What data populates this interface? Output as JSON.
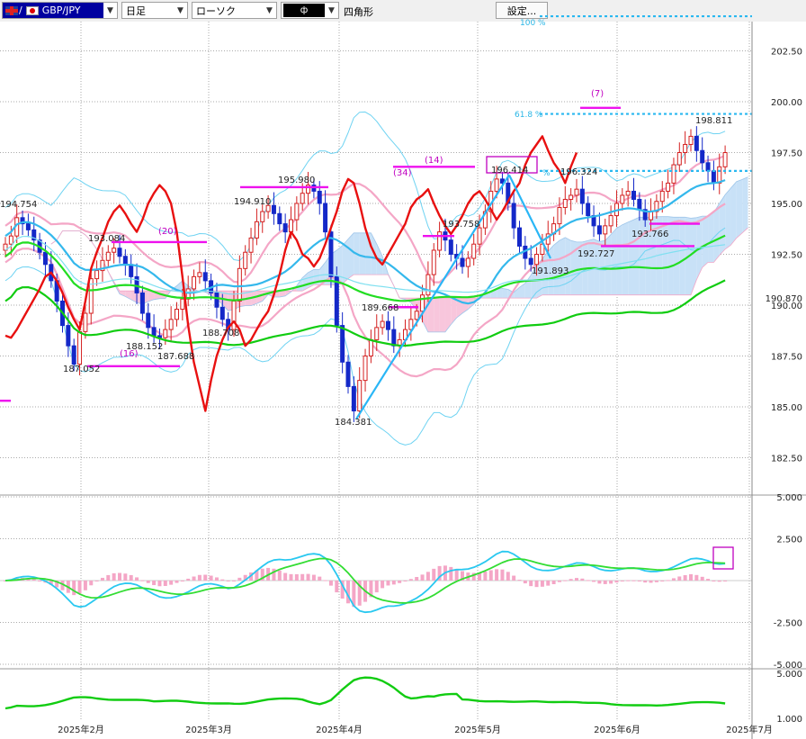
{
  "toolbar": {
    "pair": "GBP/JPY",
    "pair_separator": "/",
    "period": "日足",
    "chart_type": "ローソク",
    "color_value": "ф",
    "shape": "四角形",
    "settings_label": "設定..."
  },
  "chart_data": {
    "type": "candlestick",
    "symbol": "GBP/JPY",
    "period": "日足",
    "main_yaxis_ticks": [
      "202.50",
      "200.00",
      "197.50",
      "195.00",
      "192.50",
      "190.00",
      "187.50",
      "185.00",
      "182.50"
    ],
    "ylim": [
      181.5,
      204.3
    ],
    "current_price_label": "190.870",
    "x_labels": [
      "2025年2月",
      "2025年3月",
      "2025年4月",
      "2025年5月",
      "2025年6月",
      "2025年7月"
    ],
    "price_annotations": [
      "194.754",
      "193.084",
      "195.980",
      "194.910",
      "187.052",
      "188.152",
      "187.688",
      "188.708",
      "184.381",
      "189.668",
      "193.758",
      "196.414",
      "196.324",
      "191.893",
      "192.727",
      "193.766",
      "198.811"
    ],
    "ichimoku_counts": [
      "(20)",
      "(16)",
      "(34)",
      "(14)",
      "(7)"
    ],
    "fibonacci_labels": [
      "100 %",
      "61.8 %",
      "%"
    ],
    "macd_axis_ticks": [
      "5.000",
      "2.500",
      "-2.500",
      "-5.000"
    ],
    "sub_axis_ticks": [
      "5.000",
      "1.000"
    ],
    "close": [
      193.0,
      193.4,
      194.3,
      194.0,
      193.7,
      193.2,
      192.6,
      192.0,
      191.2,
      190.2,
      189.0,
      188.0,
      187.1,
      188.7,
      189.6,
      191.3,
      191.7,
      192.2,
      192.6,
      192.8,
      192.4,
      192.0,
      191.4,
      190.6,
      189.6,
      188.9,
      188.5,
      188.4,
      188.8,
      189.3,
      189.8,
      190.3,
      190.8,
      191.4,
      191.6,
      191.2,
      190.6,
      189.9,
      189.3,
      188.8,
      190.2,
      191.8,
      192.6,
      193.3,
      194.1,
      194.6,
      194.9,
      194.5,
      194.0,
      193.6,
      194.2,
      195.0,
      195.5,
      195.9,
      195.6,
      195.0,
      193.6,
      191.4,
      189.0,
      187.2,
      186.0,
      184.8,
      186.3,
      187.5,
      188.3,
      188.9,
      189.2,
      188.8,
      188.0,
      188.3,
      188.8,
      189.3,
      189.7,
      190.5,
      191.5,
      192.7,
      193.6,
      193.2,
      192.5,
      192.3,
      191.9,
      192.3,
      193.0,
      193.8,
      194.6,
      195.6,
      196.2,
      196.0,
      195.0,
      193.8,
      192.9,
      192.3,
      192.0,
      192.5,
      193.0,
      193.5,
      194.0,
      194.8,
      195.2,
      195.4,
      195.7,
      195.0,
      194.4,
      193.9,
      193.5,
      193.9,
      194.4,
      195.0,
      195.4,
      195.6,
      195.2,
      194.7,
      194.2,
      194.6,
      195.1,
      195.6,
      196.0,
      196.9,
      197.5,
      197.9,
      198.3,
      197.6,
      197.0,
      196.6,
      196.0,
      196.8,
      197.5
    ]
  }
}
